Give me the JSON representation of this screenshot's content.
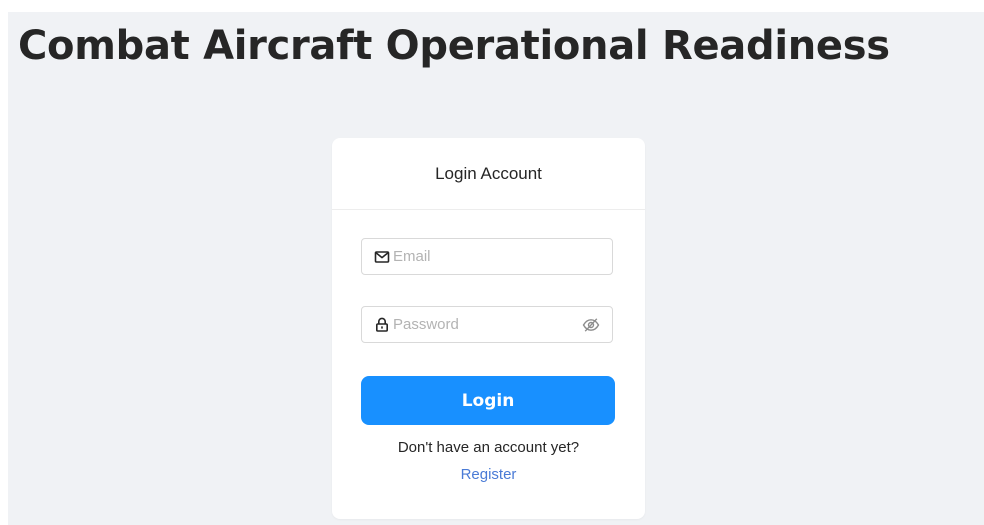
{
  "header": {
    "title": "Combat Aircraft Operational Readiness"
  },
  "login_card": {
    "title": "Login Account",
    "email": {
      "placeholder": "Email",
      "value": "",
      "icon": "mail-icon"
    },
    "password": {
      "placeholder": "Password",
      "value": "",
      "icon": "lock-icon",
      "toggle_icon": "eye-slash-icon"
    },
    "login_label": "Login",
    "register_prompt": "Don't have an account yet?",
    "register_label": "Register"
  },
  "colors": {
    "page_background": "#f0f2f5",
    "card_background": "#ffffff",
    "primary_button": "#1890ff",
    "link": "#4a7bd6",
    "text": "#262626",
    "placeholder": "#b3b3b3"
  }
}
